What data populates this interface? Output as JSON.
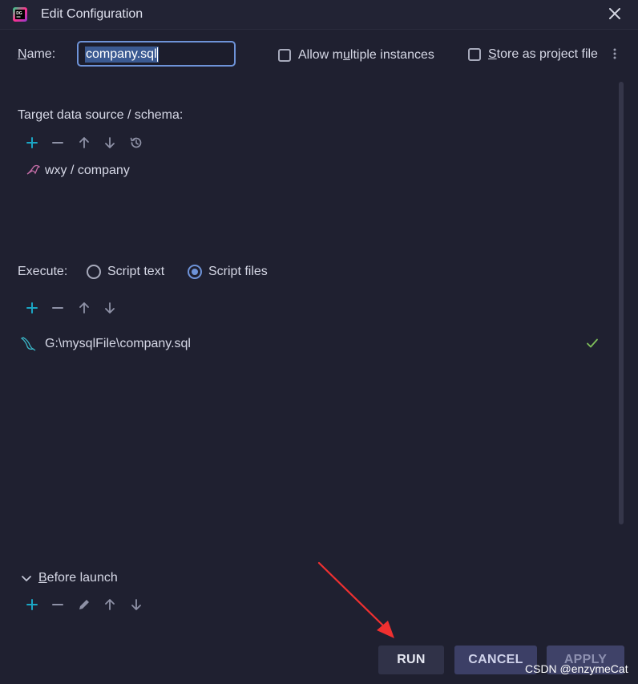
{
  "window": {
    "title": "Edit Configuration"
  },
  "name_row": {
    "label_mnemonic": "N",
    "label_rest": "ame:",
    "value": "company.sql",
    "allow_multiple_pre": "Allow m",
    "allow_multiple_mnemonic": "u",
    "allow_multiple_post": "ltiple instances",
    "store_mnemonic": "S",
    "store_post": "tore as project file"
  },
  "target": {
    "label": "Target data source / schema:",
    "item": "wxy / company"
  },
  "execute": {
    "label": "Execute:",
    "options": [
      {
        "label": "Script text",
        "selected": false
      },
      {
        "label": "Script files",
        "selected": true
      }
    ],
    "file": "G:\\mysqlFile\\company.sql"
  },
  "before_launch": {
    "mnemonic": "B",
    "label_rest": "efore launch"
  },
  "buttons": {
    "run": "RUN",
    "cancel": "CANCEL",
    "apply": "APPLY"
  },
  "watermark": "CSDN @enzymeCat",
  "colors": {
    "background": "#1f2030",
    "accent": "#6e93d8",
    "add_icon": "#1ba6c4",
    "check": "#7fbf5a",
    "arrow": "#f03030"
  }
}
